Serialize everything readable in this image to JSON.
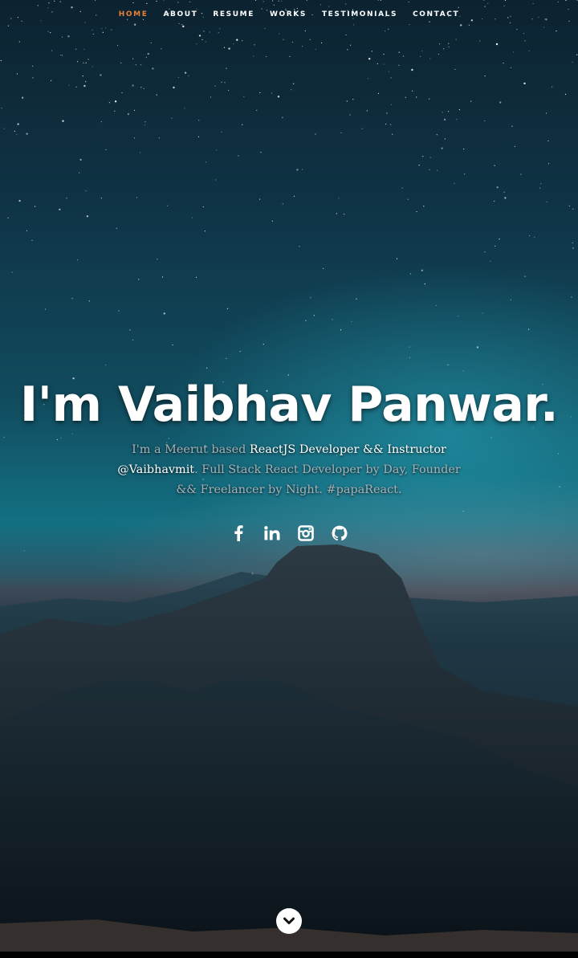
{
  "nav": {
    "items": [
      {
        "label": "HOME",
        "active": true
      },
      {
        "label": "ABOUT"
      },
      {
        "label": "RESUME"
      },
      {
        "label": "WORKS"
      },
      {
        "label": "TESTIMONIALS"
      },
      {
        "label": "CONTACT"
      }
    ]
  },
  "banner": {
    "headline": "I'm Vaibhav Panwar.",
    "desc_part1": "I'm a Meerut based ",
    "desc_highlight1": "ReactJS Developer && Instructor",
    "desc_highlight2": "@Vaibhavmit",
    "desc_part2": ". Full Stack React Developer by Day, Founder && Freelancer by Night. #papaReact."
  },
  "social": [
    {
      "icon": "facebook-icon"
    },
    {
      "icon": "linkedin-icon"
    },
    {
      "icon": "instagram-icon"
    },
    {
      "icon": "github-icon"
    }
  ],
  "scroll": {
    "icon": "chevron-down-icon"
  },
  "colors": {
    "accent": "#e8803a",
    "text": "#ffffff",
    "muted_text": "#a7b2b8"
  }
}
